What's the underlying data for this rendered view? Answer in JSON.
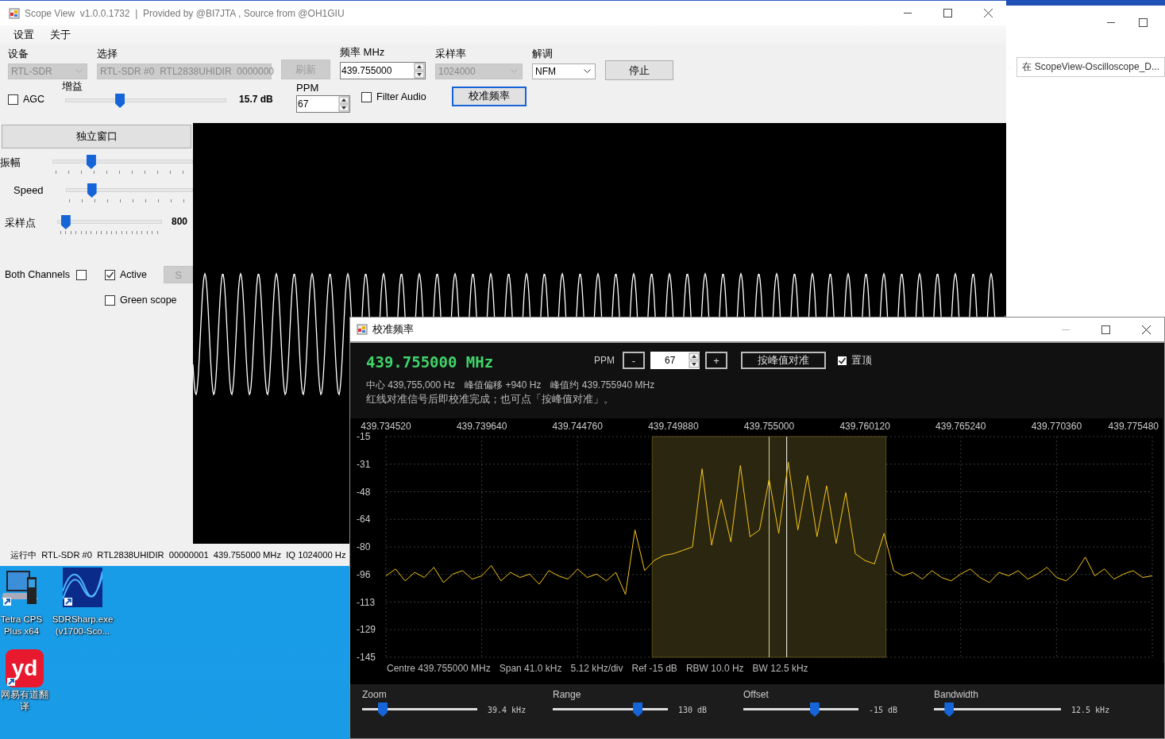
{
  "main_window": {
    "title": "Scope View  v1.0.0.1732  |  Provided by @BI7JTA , Source from @OH1GIU",
    "menu": [
      "设置",
      "关于"
    ],
    "fields": [
      {
        "kind": "combo",
        "label": "设备",
        "value": "RTL-SDR",
        "disabled": true
      },
      {
        "kind": "combo",
        "label": "选择",
        "value": "RTL-SDR #0  RTL2838UHIDIR  0000000",
        "disabled": true
      },
      {
        "kind": "button",
        "label": "刷新",
        "disabled": true
      },
      {
        "kind": "spin",
        "label": "频率 MHz",
        "value": "439.755000"
      },
      {
        "kind": "combo",
        "label": "采样率",
        "value": "1024000",
        "disabled": true
      },
      {
        "kind": "combo",
        "label": "解调",
        "value": "NFM",
        "disabled": false
      },
      {
        "kind": "button",
        "label": "停止",
        "disabled": false
      }
    ],
    "agc": {
      "label": "AGC",
      "checked": false
    },
    "gain": {
      "label": "增益",
      "level": 0.33,
      "reading": "15.7 dB"
    },
    "ppm": {
      "label": "PPM",
      "value": "67"
    },
    "filter_audio": {
      "label": "Filter Audio",
      "checked": false
    },
    "calibrate_button": {
      "label": "校准频率",
      "focused": true
    },
    "left_panel": {
      "window_button": "独立窗口",
      "sliders": [
        {
          "label": "振幅",
          "level": 0.26
        },
        {
          "label": "Speed",
          "level": 0.18
        },
        {
          "label": "采样点",
          "level": 0.04,
          "reading": "800"
        }
      ],
      "checkboxes": [
        {
          "label": "Both Channels",
          "checked": false
        },
        {
          "label": "Active",
          "checked": true
        },
        {
          "label": "Green scope",
          "checked": false
        }
      ],
      "s_button": {
        "label": "S",
        "disabled": true
      }
    },
    "status_bar": "运行中  RTL-SDR #0  RTL2838UHIDIR  00000001  439.755000 MHz  IQ 1024000 Hz"
  },
  "browser": {
    "address": "在 ScopeView-Oscilloscope_D..."
  },
  "desktop_icons": [
    {
      "kind": "laptop",
      "label": "Tetra CPS Plus x64"
    },
    {
      "kind": "wave",
      "label": "SDRSharp.exe (v1700-Sco..."
    },
    {
      "kind": "badge",
      "badge_text": "yd",
      "label": "网易有道翻译"
    }
  ],
  "calibration_window": {
    "title": "校准频率",
    "frequency": "439.755000 MHz",
    "ppm_label": "PPM",
    "ppm_minus": "-",
    "ppm_value": "67",
    "ppm_plus": "+",
    "peak_button": "按峰值对准",
    "topmost": {
      "label": "置顶",
      "checked": true
    },
    "info": [
      "中心 439,755,000 Hz",
      "峰值偏移 +940 Hz",
      "峰值约 439.755940 MHz"
    ],
    "hint": "红线对准信号后即校准完成；也可点「按峰值对准」。",
    "chart_data": {
      "type": "line",
      "grid": true,
      "bands": [
        {
          "axis": "x",
          "from": 439.74875,
          "to": 439.76125,
          "color": "#2b2610"
        }
      ],
      "ref_lines": [
        {
          "axis": "x",
          "value": 439.755,
          "color": "#d8d0a0"
        },
        {
          "axis": "x",
          "value": 439.75594,
          "color": "#ffffff"
        }
      ],
      "x": [
        439.73452,
        439.735032,
        439.735544,
        439.736056,
        439.736568,
        439.73708,
        439.737592,
        439.738104,
        439.738616,
        439.739128,
        439.73964,
        439.740152,
        439.740664,
        439.741176,
        439.741688,
        439.7422,
        439.742712,
        439.743224,
        439.743736,
        439.744248,
        439.74476,
        439.745272,
        439.745784,
        439.746296,
        439.746808,
        439.74732,
        439.747832,
        439.748344,
        439.748856,
        439.749368,
        439.74988,
        439.750392,
        439.750904,
        439.751416,
        439.751928,
        439.75244,
        439.752952,
        439.753464,
        439.753976,
        439.754488,
        439.755,
        439.755512,
        439.756024,
        439.756536,
        439.757048,
        439.75756,
        439.758072,
        439.758584,
        439.759096,
        439.759608,
        439.76012,
        439.760632,
        439.761144,
        439.761656,
        439.762168,
        439.76268,
        439.763192,
        439.763704,
        439.764216,
        439.764728,
        439.76524,
        439.765752,
        439.766264,
        439.766776,
        439.767288,
        439.7678,
        439.768312,
        439.768824,
        439.769336,
        439.769848,
        439.77036,
        439.770872,
        439.771384,
        439.771896,
        439.772408,
        439.77292,
        439.773432,
        439.773944,
        439.774456,
        439.774968,
        439.77548
      ],
      "xlim": [
        439.73452,
        439.77548
      ],
      "ylim": [
        -145,
        -15
      ],
      "xticks": [
        {
          "value": 439.73452,
          "label": "439.734520"
        },
        {
          "value": 439.73964,
          "label": "439.739640"
        },
        {
          "value": 439.74476,
          "label": "439.744760"
        },
        {
          "value": 439.74988,
          "label": "439.749880"
        },
        {
          "value": 439.755,
          "label": "439.755000"
        },
        {
          "value": 439.76012,
          "label": "439.760120"
        },
        {
          "value": 439.76524,
          "label": "439.765240"
        },
        {
          "value": 439.77036,
          "label": "439.770360"
        },
        {
          "value": 439.77548,
          "label": "439.775480"
        }
      ],
      "yticks": [
        {
          "value": -15,
          "label": "-15"
        },
        {
          "value": -31.25,
          "label": "-31"
        },
        {
          "value": -47.5,
          "label": "-48"
        },
        {
          "value": -63.75,
          "label": "-64"
        },
        {
          "value": -80,
          "label": "-80"
        },
        {
          "value": -96.25,
          "label": "-96"
        },
        {
          "value": -112.5,
          "label": "-113"
        },
        {
          "value": -128.75,
          "label": "-129"
        },
        {
          "value": -145,
          "label": "-145"
        }
      ],
      "series": [
        {
          "color": "#f5c518",
          "values": [
            -97,
            -93,
            -100,
            -95,
            -98,
            -92,
            -101,
            -96,
            -94,
            -99,
            -97,
            -91,
            -100,
            -95,
            -98,
            -96,
            -102,
            -94,
            -97,
            -99,
            -93,
            -98,
            -96,
            -100,
            -95,
            -108,
            -70,
            -94,
            -88,
            -85,
            -84,
            -82,
            -80,
            -34,
            -79,
            -52,
            -77,
            -32,
            -74,
            -70,
            -40,
            -72,
            -30,
            -70,
            -38,
            -74,
            -44,
            -78,
            -48,
            -84,
            -88,
            -90,
            -72,
            -94,
            -97,
            -95,
            -99,
            -94,
            -98,
            -100,
            -96,
            -93,
            -98,
            -101,
            -95,
            -97,
            -94,
            -99,
            -96,
            -92,
            -98,
            -100,
            -95,
            -86,
            -97,
            -93,
            -99,
            -96,
            -94,
            -98,
            -97
          ]
        }
      ]
    },
    "footer": [
      "Centre 439.755000 MHz",
      "Span 41.0 kHz",
      "5.12 kHz/div",
      "Ref -15 dB",
      "RBW 10.0 Hz",
      "BW 12.5 kHz"
    ],
    "sliders": [
      {
        "label": "Zoom",
        "level": 0.15,
        "reading": "39.4 kHz"
      },
      {
        "label": "Range",
        "level": 0.76,
        "reading": "130 dB"
      },
      {
        "label": "Offset",
        "level": 0.63,
        "reading": "-15 dB"
      },
      {
        "label": "Bandwidth",
        "level": 0.09,
        "reading": "12.5 kHz"
      }
    ]
  }
}
